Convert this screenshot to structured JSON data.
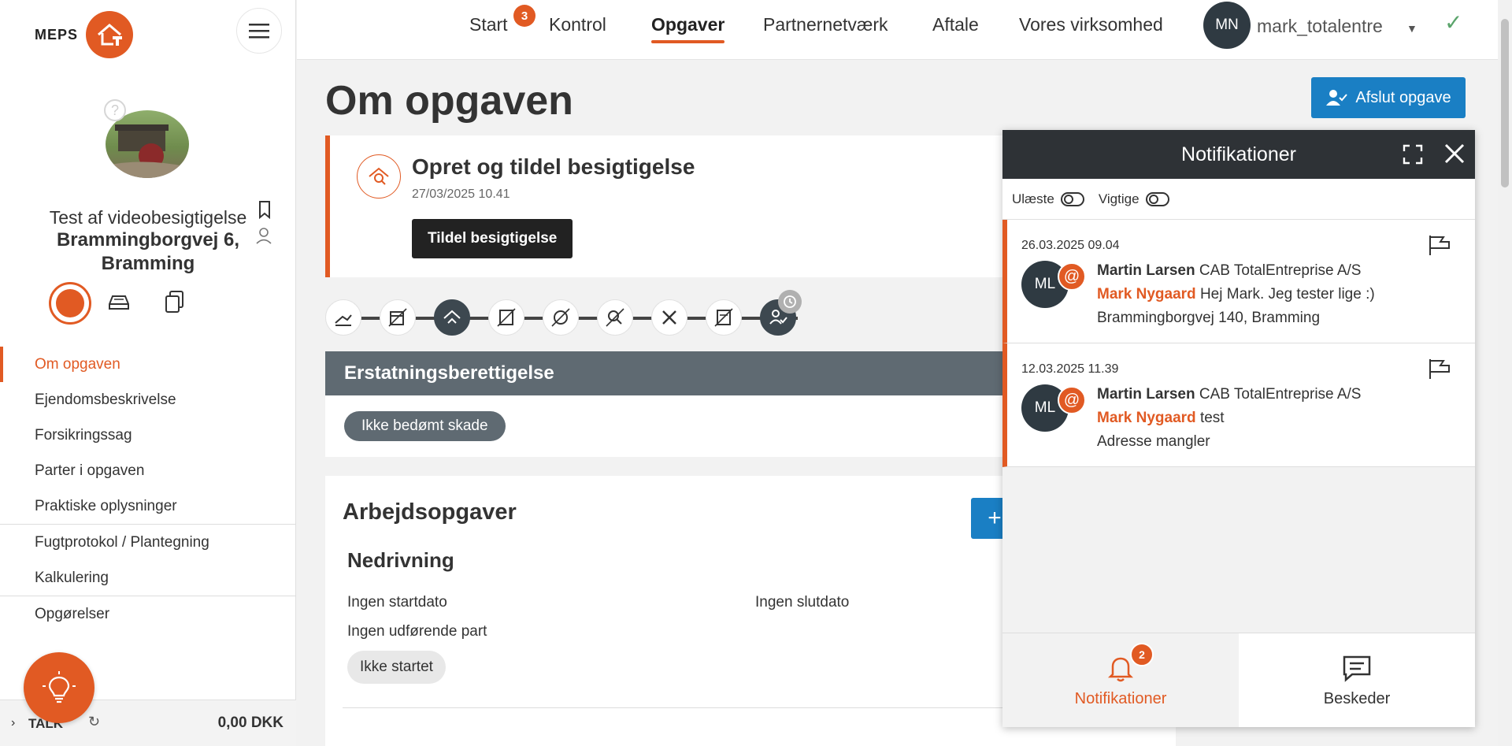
{
  "brand": {
    "logo_text": "MEPS",
    "accent": "#e15a23",
    "primary_blue": "#1a7fc4"
  },
  "topnav": {
    "items": [
      {
        "label": "Start",
        "badge": "3"
      },
      {
        "label": "Kontrol"
      },
      {
        "label": "Opgaver",
        "active": true
      },
      {
        "label": "Partnernetværk"
      },
      {
        "label": "Aftale"
      },
      {
        "label": "Vores virksomhed"
      }
    ],
    "user_initials": "MN",
    "username": "mark_totalentre"
  },
  "sidebar": {
    "task_title": "Test af videobesigtigelse",
    "task_address": "Brammingborgvej 6, Bramming",
    "nav": [
      {
        "label": "Om opgaven",
        "active": true
      },
      {
        "label": "Ejendomsbeskrivelse"
      },
      {
        "label": "Forsikringssag"
      },
      {
        "label": "Parter i opgaven"
      },
      {
        "label": "Praktiske oplysninger"
      },
      {
        "label": "Fugtprotokol / Plantegning"
      },
      {
        "label": "Kalkulering"
      },
      {
        "label": "Opgørelser"
      }
    ],
    "talk": {
      "label": "TALK",
      "amount": "0,00 DKK"
    }
  },
  "main": {
    "page_title": "Om opgaven",
    "close_task_label": "Afslut opgave",
    "event": {
      "title": "Opret og tildel besigtigelse",
      "date": "27/03/2025 10.41",
      "button": "Tildel besigtigelse"
    },
    "compensation": {
      "title": "Erstatningsberettigelse",
      "status": "Ikke bedømt skade"
    },
    "work": {
      "title": "Arbejdsopgaver",
      "add_label": "+",
      "sub_title": "Nedrivning",
      "start": "Ingen startdato",
      "end": "Ingen slutdato",
      "party": "Ingen udførende part",
      "status": "Ikke startet"
    }
  },
  "notifications": {
    "title": "Notifikationer",
    "filters": {
      "unread": "Ulæste",
      "important": "Vigtige"
    },
    "items": [
      {
        "date": "26.03.2025 09.04",
        "initials": "ML",
        "sender": "Martin Larsen",
        "company": "CAB TotalEntreprise A/S",
        "mention": "Mark Nygaard",
        "message": "Hej Mark. Jeg tester lige :)",
        "address": "Brammingborgvej 140, Bramming"
      },
      {
        "date": "12.03.2025 11.39",
        "initials": "ML",
        "sender": "Martin Larsen",
        "company": "CAB TotalEntreprise A/S",
        "mention": "Mark Nygaard",
        "message": "test",
        "address": "Adresse mangler"
      }
    ],
    "footer": {
      "notifications_label": "Notifikationer",
      "notifications_badge": "2",
      "messages_label": "Beskeder"
    }
  }
}
